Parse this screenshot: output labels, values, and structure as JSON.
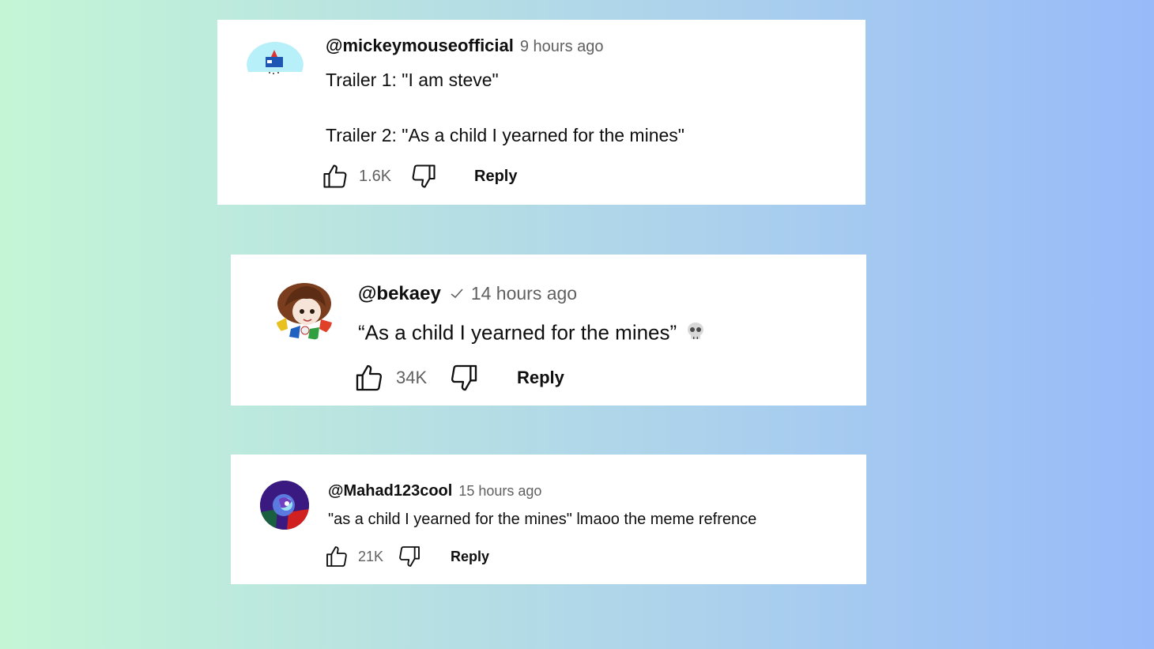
{
  "comments": [
    {
      "handle": "@mickeymouseofficial",
      "time": "9 hours ago",
      "verified": false,
      "text_line1": "Trailer 1: \"I am steve\"",
      "text_line2": "Trailer 2: \"As a child I yearned for the mines\"",
      "likes": "1.6K",
      "reply_label": "Reply",
      "avatar_icon": "cartoon-avatar-icon"
    },
    {
      "handle": "@bekaey",
      "time": "14 hours ago",
      "verified": true,
      "text_line1": "“As a child I yearned for the mines”",
      "emoji": "💀",
      "likes": "34K",
      "reply_label": "Reply",
      "avatar_icon": "anime-avatar-icon"
    },
    {
      "handle": "@Mahad123cool",
      "time": "15 hours ago",
      "verified": false,
      "text_line1": "\"as a child I yearned for the mines\" lmaoo the meme refrence",
      "likes": "21K",
      "reply_label": "Reply",
      "avatar_icon": "abstract-avatar-icon"
    }
  ],
  "colors": {
    "card_background": "#ffffff",
    "handle_text": "#0f0f0f",
    "meta_text": "#606060",
    "gradient_start": "#c4f6d6",
    "gradient_end": "#98baf9"
  }
}
